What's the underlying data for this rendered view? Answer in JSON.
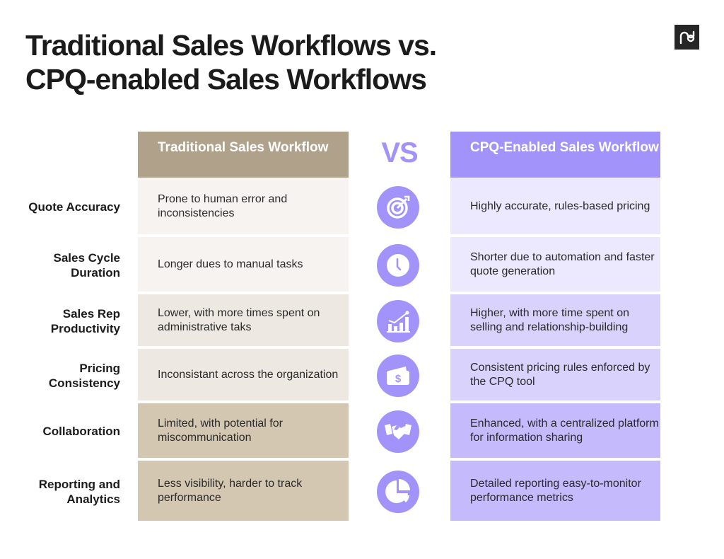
{
  "title": {
    "line1": "Traditional Sales Workflows vs.",
    "line2": "CPQ-enabled Sales Workflows"
  },
  "logo": {
    "icon": "pd-logo-icon",
    "text": "pd"
  },
  "columns": {
    "traditional": {
      "header": "Traditional Sales Workflow",
      "color": "#b0a28a"
    },
    "vs": "VS",
    "cpq": {
      "header": "CPQ-Enabled Sales Workflow",
      "color": "#a193fa"
    }
  },
  "rows": [
    {
      "label": "Quote Accuracy",
      "traditional": "Prone to human error and inconsistencies",
      "cpq": "Highly accurate, rules-based pricing",
      "icon": "target-icon",
      "trad_bg": "#f6f3f0",
      "cpq_bg": "#ece8fe"
    },
    {
      "label": "Sales Cycle Duration",
      "traditional": "Longer dues to manual tasks",
      "cpq": "Shorter due to automation and faster quote generation",
      "icon": "clock-icon",
      "trad_bg": "#f6f3f0",
      "cpq_bg": "#ece8fe"
    },
    {
      "label": "Sales Rep Productivity",
      "traditional": "Lower, with more times spent on administrative taks",
      "cpq": "Higher, with more time spent on selling and relationship-building",
      "icon": "growth-chart-icon",
      "trad_bg": "#ede8e1",
      "cpq_bg": "#d9d2fd"
    },
    {
      "label": "Pricing Consistency",
      "traditional": "Inconsistant across the organization",
      "cpq": "Consistent pricing rules enforced by the CPQ tool",
      "icon": "money-wallet-icon",
      "trad_bg": "#ede8e1",
      "cpq_bg": "#d9d2fd"
    },
    {
      "label": "Collaboration",
      "traditional": "Limited, with potential for miscommunication",
      "cpq": "Enhanced, with a centralized platform for information sharing",
      "icon": "handshake-icon",
      "trad_bg": "#d3c7b2",
      "cpq_bg": "#c5bbfc"
    },
    {
      "label": "Reporting and Analytics",
      "traditional": "Less visibility, harder to track performance",
      "cpq": "Detailed reporting easy-to-monitor performance metrics",
      "icon": "pie-chart-icon",
      "trad_bg": "#d3c7b2",
      "cpq_bg": "#c5bbfc"
    }
  ]
}
